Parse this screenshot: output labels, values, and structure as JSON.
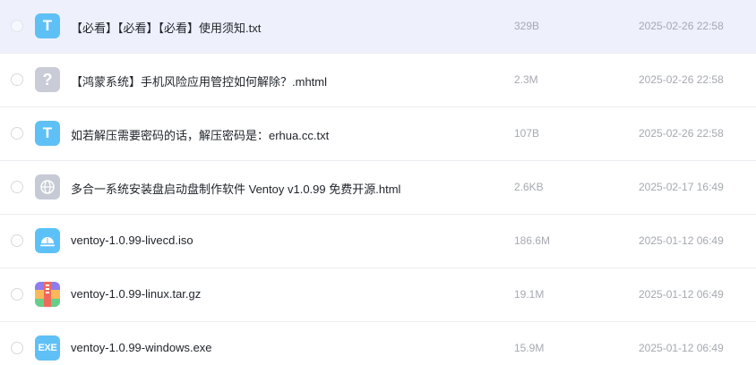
{
  "files": [
    {
      "name": "【必看】【必看】【必看】使用须知.txt",
      "size": "329B",
      "date": "2025-02-26 22:58",
      "icon": "txt-file-icon",
      "icon_glyph": "T"
    },
    {
      "name": "【鸿蒙系统】手机风险应用管控如何解除？.mhtml",
      "size": "2.3M",
      "date": "2025-02-26 22:58",
      "icon": "unknown-file-icon",
      "icon_glyph": "?"
    },
    {
      "name": "如若解压需要密码的话，解压密码是：erhua.cc.txt",
      "size": "107B",
      "date": "2025-02-26 22:58",
      "icon": "txt-file-icon",
      "icon_glyph": "T"
    },
    {
      "name": "多合一系统安装盘启动盘制作软件 Ventoy v1.0.99 免费开源.html",
      "size": "2.6KB",
      "date": "2025-02-17 16:49",
      "icon": "globe-file-icon"
    },
    {
      "name": "ventoy-1.0.99-livecd.iso",
      "size": "186.6M",
      "date": "2025-01-12 06:49",
      "icon": "disc-image-icon"
    },
    {
      "name": "ventoy-1.0.99-linux.tar.gz",
      "size": "19.1M",
      "date": "2025-01-12 06:49",
      "icon": "archive-file-icon"
    },
    {
      "name": "ventoy-1.0.99-windows.exe",
      "size": "15.9M",
      "date": "2025-01-12 06:49",
      "icon": "exe-file-icon",
      "icon_glyph": "EXE"
    }
  ],
  "colors": {
    "selected_row": "#eef1fc",
    "text_primary": "#1f2329",
    "text_secondary": "#a6a9b0",
    "divider": "#ecedf0"
  }
}
